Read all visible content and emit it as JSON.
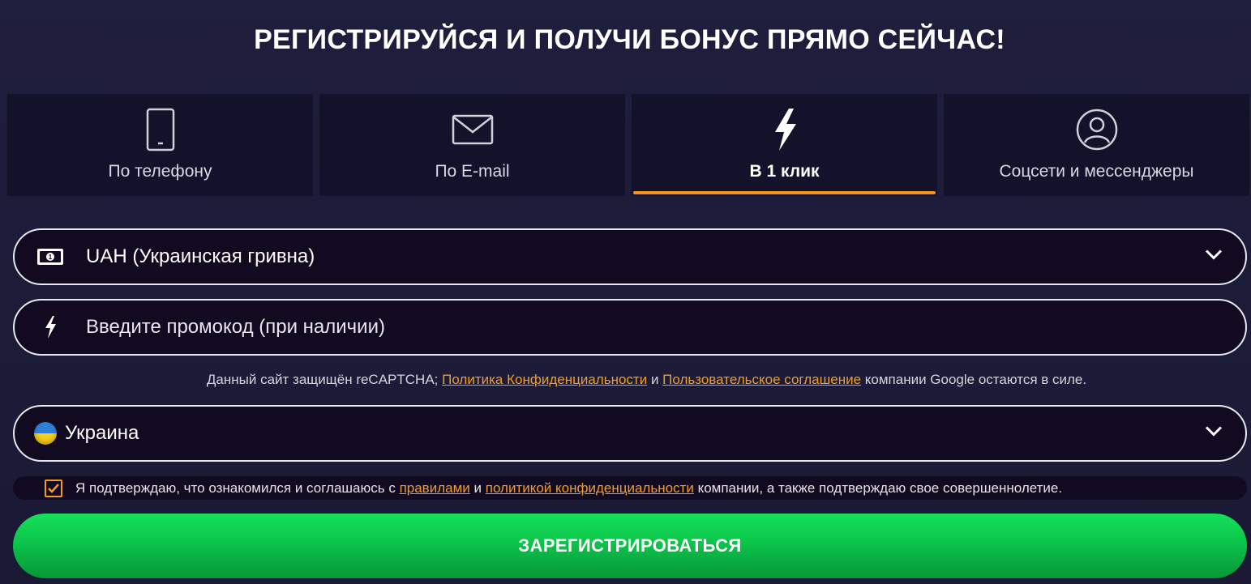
{
  "title": "РЕГИСТРИРУЙСЯ И ПОЛУЧИ БОНУС ПРЯМО СЕЙЧАС!",
  "colors": {
    "accent": "#f39c2a",
    "button_green": "#0cc44a",
    "background": "#1c1c38",
    "field_bg": "#110a20"
  },
  "tabs": [
    {
      "label": "По телефону",
      "icon": "phone-icon",
      "active": false
    },
    {
      "label": "По E-mail",
      "icon": "envelope-icon",
      "active": false
    },
    {
      "label": "В 1 клик",
      "icon": "lightning-icon",
      "active": true
    },
    {
      "label": "Соцсети и мессенджеры",
      "icon": "user-circle-icon",
      "active": false
    }
  ],
  "currency": {
    "icon": "banknote-icon",
    "value": "UAH (Украинская гривна)"
  },
  "promo": {
    "icon": "lightning-icon",
    "placeholder": "Введите промокод (при наличии)",
    "value": ""
  },
  "recaptcha": {
    "prefix": "Данный сайт защищён reCAPTCHA;",
    "privacy_link": "Политика Конфиденциальности",
    "and": "и",
    "terms_link": "Пользовательское соглашение",
    "suffix": "компании Google остаются в силе."
  },
  "country": {
    "icon": "ukraine-flag-icon",
    "value": "Украина"
  },
  "agreement": {
    "checked": true,
    "prefix": "Я подтверждаю, что ознакомился и соглашаюсь с",
    "rules_link": "правилами",
    "and": "и",
    "policy_link": "политикой конфиденциальности",
    "suffix": "компании, а также подтверждаю свое совершеннолетие."
  },
  "submit_label": "ЗАРЕГИСТРИРОВАТЬСЯ"
}
